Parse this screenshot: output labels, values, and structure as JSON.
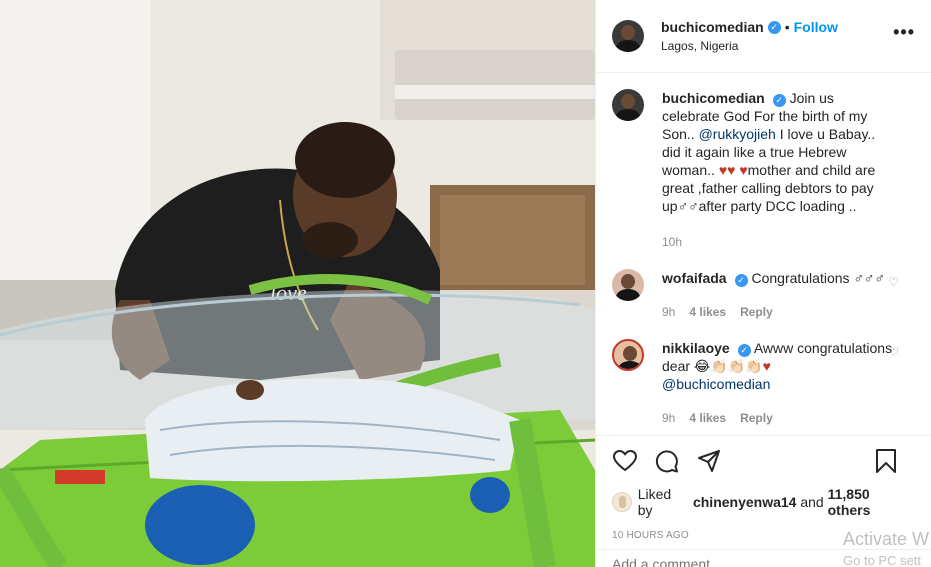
{
  "post": {
    "username": "buchicomedian",
    "follow_label": "Follow",
    "location": "Lagos, Nigeria",
    "more_label": "•••"
  },
  "caption": {
    "username": "buchicomedian",
    "text_part1": "Join us celebrate God For the birth of my Son..",
    "mention": "@rukkyojieh",
    "text_part2": "I love u Babay.. did it again like a true Hebrew woman..",
    "hearts": "♥♥",
    "heart3": "♥",
    "text_part3": "mother and child are great ,father calling debtors to pay up♂♂after party DCC loading ..",
    "time": "10h"
  },
  "comments": [
    {
      "username": "wofaifada",
      "text": "Congratulations ♂♂♂",
      "time": "9h",
      "likes": "4 likes",
      "reply": "Reply"
    },
    {
      "username": "nikkilaoye",
      "text": "Awww congratulations dear 😂👏🏻👏🏻👏🏻",
      "heart": "♥",
      "mention": "@buchicomedian",
      "time": "9h",
      "likes": "4 likes",
      "reply": "Reply"
    }
  ],
  "likes": {
    "prefix": "Liked by",
    "user": "chinenyenwa14",
    "middle": "and",
    "others": "11,850 others"
  },
  "timestamp": "10 HOURS AGO",
  "add_comment": {
    "placeholder": "Add a comment..."
  },
  "watermark": {
    "line1": "Activate W",
    "line2": "Go to PC sett"
  },
  "colors": {
    "accent": "#0095f6",
    "heart": "#ed4956",
    "muted": "#8e8e8e"
  }
}
